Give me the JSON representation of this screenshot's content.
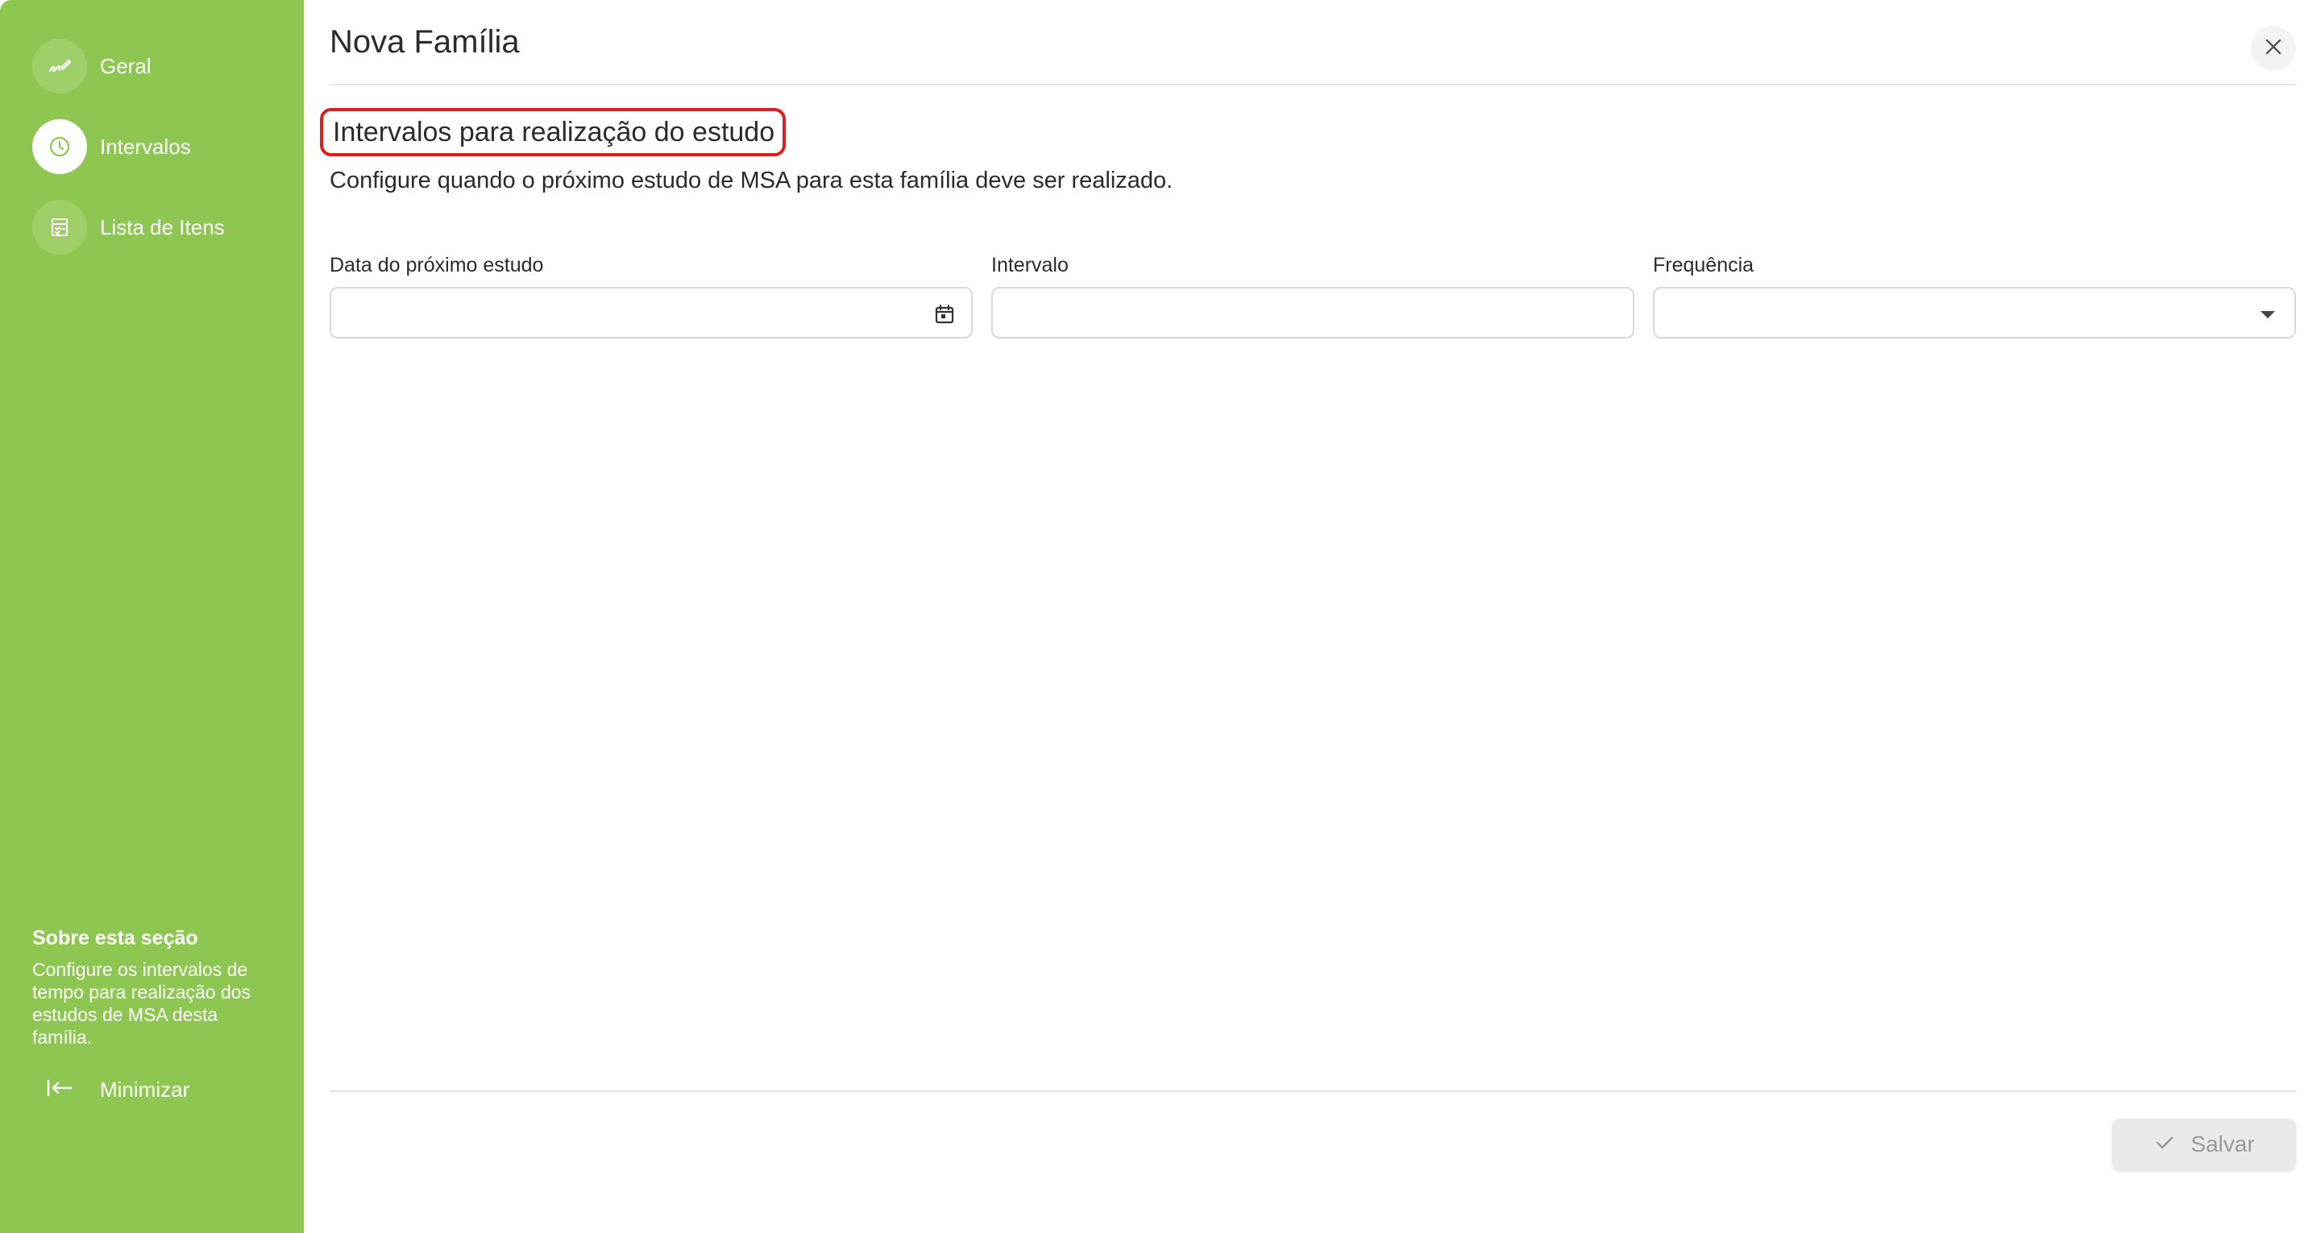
{
  "colors": {
    "sidebar_bg": "#8dc650",
    "accent_green": "#8dc650",
    "highlight_border": "#e01e1e",
    "text_primary": "#2b2b2b",
    "disabled_button_bg": "#e9e9e9",
    "disabled_button_text": "#9a9a9a"
  },
  "sidebar": {
    "items": [
      {
        "label": "Geral",
        "icon": "pen-signature-icon",
        "active": false
      },
      {
        "label": "Intervalos",
        "icon": "clock-icon",
        "active": true
      },
      {
        "label": "Lista de Itens",
        "icon": "checklist-icon",
        "active": false
      }
    ],
    "about": {
      "title": "Sobre esta seção",
      "text": "Configure os intervalos de tempo para realização dos estudos de MSA desta família."
    },
    "minimize_label": "Minimizar"
  },
  "header": {
    "title": "Nova Família",
    "close_icon": "close-icon"
  },
  "section": {
    "title": "Intervalos para realização do estudo",
    "description": "Configure quando o próximo estudo de MSA para esta família deve ser realizado."
  },
  "form": {
    "fields": [
      {
        "label": "Data do próximo estudo",
        "value": "",
        "icon": "calendar-icon"
      },
      {
        "label": "Intervalo",
        "value": ""
      },
      {
        "label": "Frequência",
        "value": "",
        "icon": "caret-down-icon"
      }
    ]
  },
  "footer": {
    "save_label": "Salvar",
    "save_icon": "check-icon",
    "save_enabled": false
  }
}
